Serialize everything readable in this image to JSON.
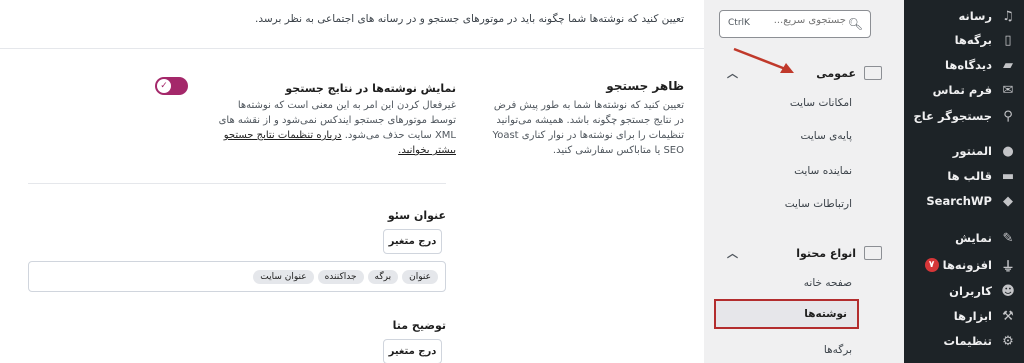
{
  "admin_menu": {
    "items": [
      {
        "label": "رسانه",
        "icon": "media-icon"
      },
      {
        "label": "برگه‌ها",
        "icon": "pages-icon"
      },
      {
        "label": "دیدگاه‌ها",
        "icon": "comments-icon"
      },
      {
        "label": "فرم تماس",
        "icon": "mail-icon"
      },
      {
        "label": "جستجوگر عاج",
        "icon": "search-icon"
      },
      {
        "label": "المنتور",
        "icon": "elementor-icon"
      },
      {
        "label": "قالب ها",
        "icon": "folder-icon"
      },
      {
        "label": "SearchWP",
        "icon": "searchwp-icon"
      },
      {
        "label": "نمایش",
        "icon": "appearance-icon"
      },
      {
        "label": "افزونه‌ها",
        "icon": "plugins-icon",
        "badge": "۷"
      },
      {
        "label": "کاربران",
        "icon": "users-icon"
      },
      {
        "label": "ابزارها",
        "icon": "tools-icon"
      },
      {
        "label": "تنظیمات",
        "icon": "settings-icon"
      }
    ]
  },
  "settings_nav": {
    "search_placeholder": "جستجوی سریع...",
    "search_shortcut": "CtrlK",
    "groups": [
      {
        "label": "عمومی",
        "items": [
          "امکانات سایت",
          "پایه‌ی سایت",
          "نماینده سایت",
          "ارتباطات سایت"
        ]
      },
      {
        "label": "انواع محتوا",
        "items": [
          "صفحه خانه",
          "نوشته‌ها",
          "برگه‌ها"
        ]
      }
    ],
    "active_item": "نوشته‌ها"
  },
  "main": {
    "intro": "تعیین کنید که نوشته‌ها شما چگونه باید در موتورهای جستجو و در رسانه های اجتماعی به نظر برسد.",
    "section_title": "ظاهر جستجو",
    "section_desc": "تعیین کنید که نوشته‌ها شما به طور پیش فرض در نتایج جستجو چگونه باشد. همیشه می‌توانید تنظیمات را برای نوشته‌ها در نوار کناری Yoast SEO یا متاباکس سفارشی کنید.",
    "toggle_title": "نمایش نوشته‌ها در نتایج جستجو",
    "toggle_state": "on",
    "toggle_desc": "غیرفعال کردن این امر به این معنی است که نوشته‌ها توسط موتورهای جستجو ایندکس نمی‌شود و از نقشه های XML سایت حذف می‌شود.",
    "toggle_link": "درباره تنظیمات نتایج جستجو بیشتر بخوانید.",
    "seo_title_label": "عنوان سئو",
    "insert_variable": "درج متغیر",
    "tags": [
      "عنوان",
      "برگه",
      "جداکننده",
      "عنوان سایت"
    ],
    "meta_desc_label": "توضیح متا",
    "insert_variable_2": "درج متغیر"
  },
  "colors": {
    "admin_bg": "#1d2327",
    "toggle": "#a4286a",
    "highlight": "#b32d2e"
  }
}
